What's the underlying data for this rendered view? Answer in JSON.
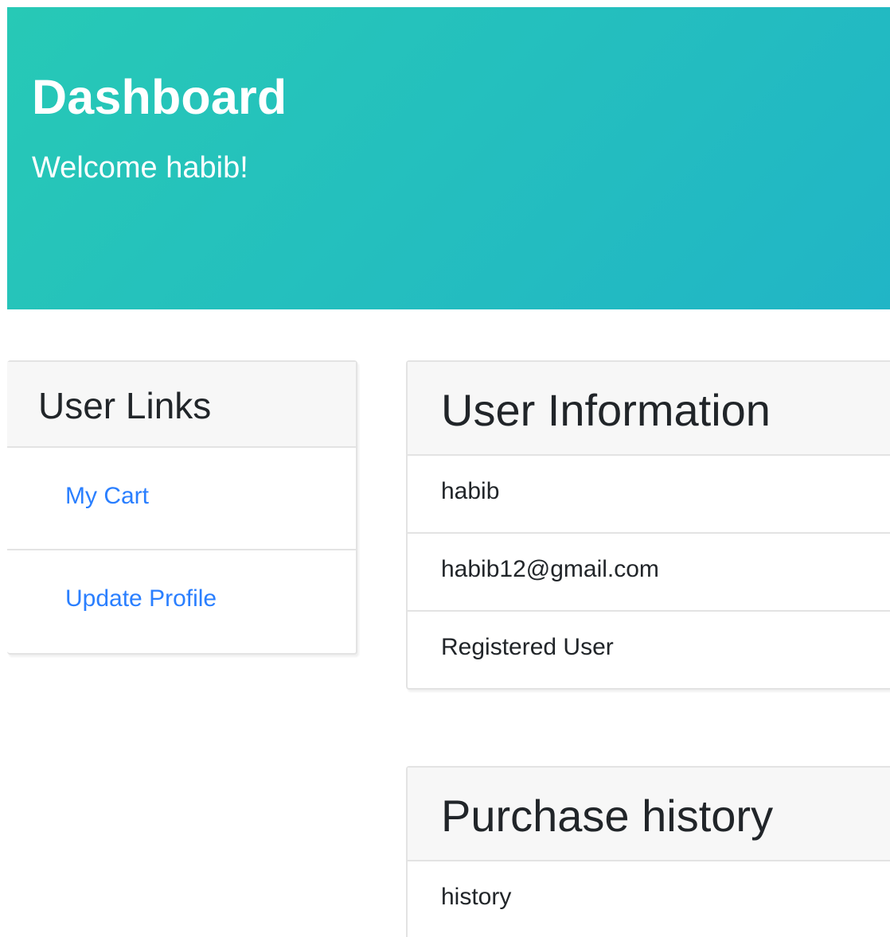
{
  "hero": {
    "title": "Dashboard",
    "subtitle": "Welcome habib!",
    "gradient_start": "#27c9b6",
    "gradient_end": "#21b5c6"
  },
  "user_links": {
    "title": "User Links",
    "items": [
      {
        "label": "My Cart"
      },
      {
        "label": "Update Profile"
      }
    ],
    "link_color": "#2a7fff"
  },
  "user_information": {
    "title": "User Information",
    "name": "habib",
    "email": "habib12@gmail.com",
    "role": "Registered User"
  },
  "purchase_history": {
    "title": "Purchase history",
    "content": "history"
  }
}
